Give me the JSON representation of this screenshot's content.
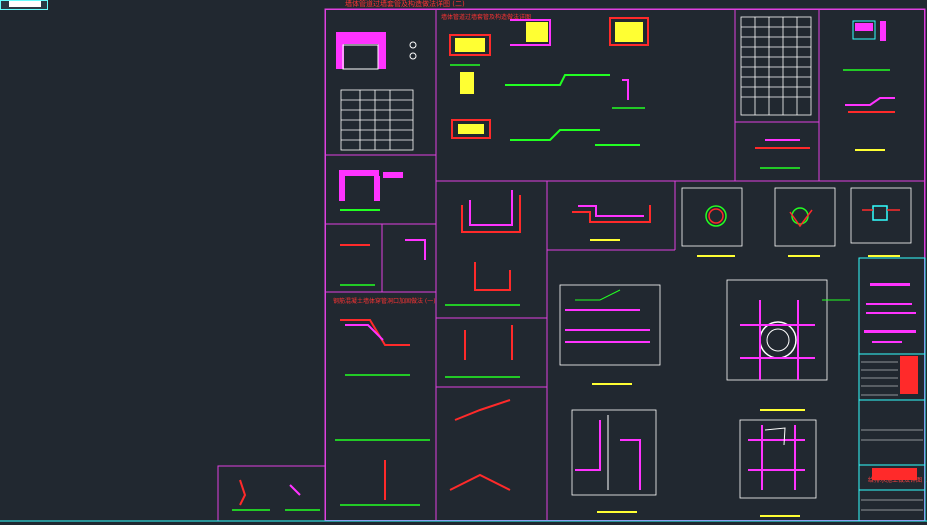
{
  "window": {
    "title": ""
  },
  "drawing": {
    "sheet_title_top": "墙体管道过墙套管及构造做法详图 (二)",
    "panel_titles": [
      "墙体管道过墙套管及构造做法详图",
      "钢筋混凝土墙体穿管洞口加固做法 (一)"
    ],
    "title_block_label": "给排水施工做法详图 (二)",
    "colors": {
      "background": "#212830",
      "frame": "#e040e0",
      "primary_lines": "#ffffff",
      "accent_red": "#ff2a2a",
      "accent_magenta": "#ff33ff",
      "accent_green": "#22ff22",
      "accent_yellow": "#ffff33",
      "accent_cyan": "#33ffff"
    },
    "icons": [
      "cad-drawing-sheet",
      "title-block",
      "detail-view"
    ]
  }
}
